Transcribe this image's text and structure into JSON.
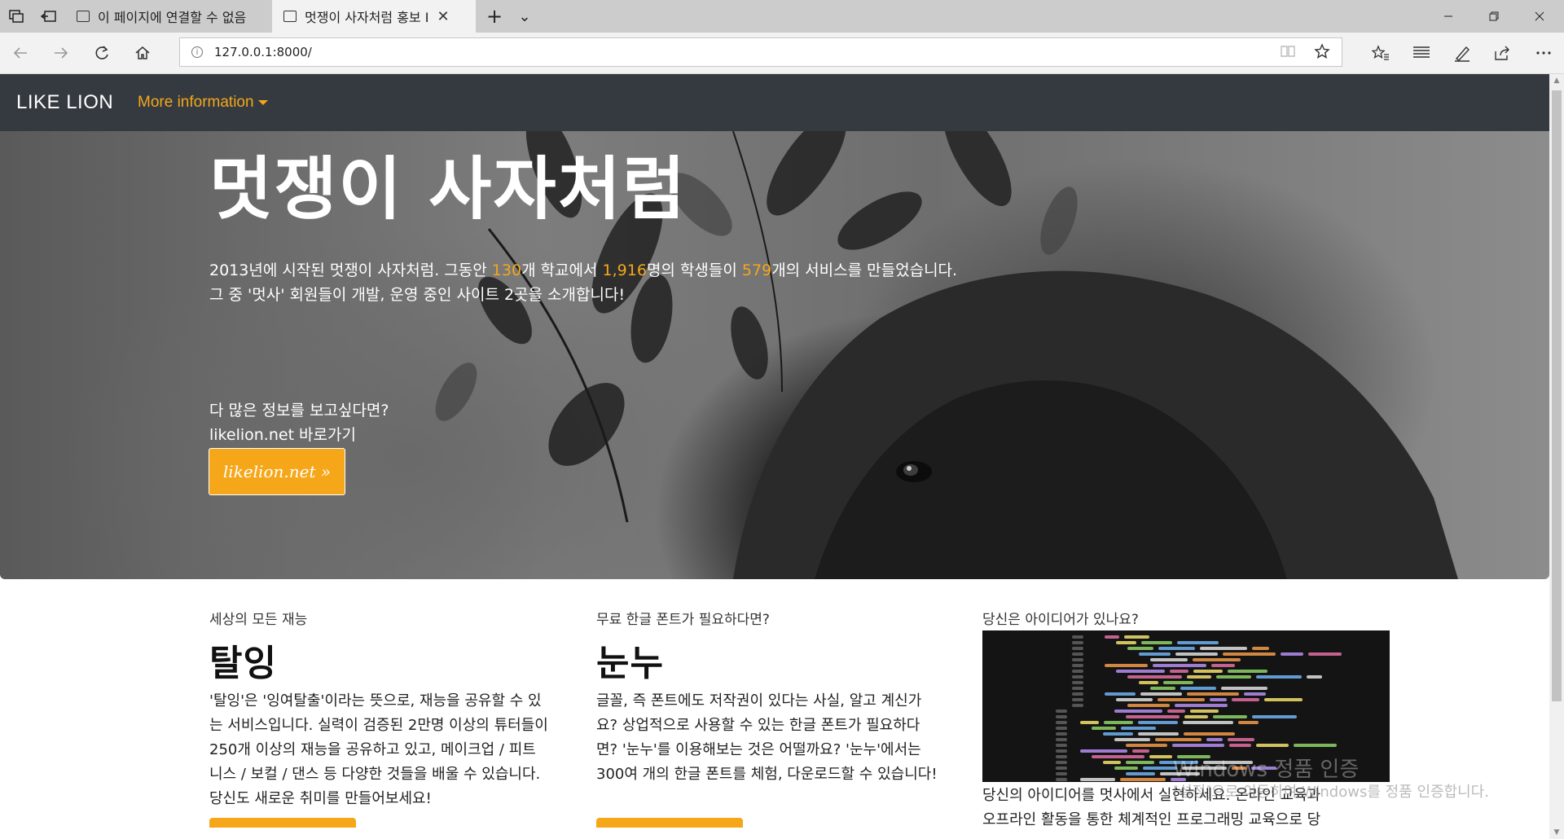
{
  "browser": {
    "tabs": [
      {
        "title": "이 페이지에 연결할 수 없음",
        "active": false
      },
      {
        "title": "멋쟁이 사자처럼 홍보 I",
        "active": true
      }
    ],
    "new_tab_glyph": "+",
    "tab_list_glyph": "⌄",
    "close_glyph": "✕",
    "url": "127.0.0.1:8000/",
    "window_controls": [
      "minimize-icon",
      "restore-icon",
      "close-icon"
    ]
  },
  "site": {
    "brand": "LIKE LION",
    "dropdown_label": "More information",
    "hero": {
      "title": "멋쟁이 사자처럼",
      "p1_a": "2013년에 시작된 멋쟁이 사자처럼. 그동안 ",
      "n_schools": "130",
      "p1_b": "개 학교에서 ",
      "n_students": "1,916",
      "p1_c": "명의 학생들이 ",
      "n_services": "579",
      "p1_d": "개의 서비스를 만들었습니다.",
      "p2": "그 중 '멋사' 회원들이 개발, 운영 중인 사이트 2곳을 소개합니다!",
      "more_q": "다 많은 정보를 보고싶다면?",
      "more_link": "likelion.net 바로가기",
      "button": "likelion.net »"
    },
    "cards": [
      {
        "subtitle": "세상의 모든 재능",
        "title": "탈잉",
        "lines": [
          "'탈잉'은 '잉여탈출'이라는 뜻으로, 재능을 공유할 수 있",
          "는 서비스입니다. 실력이 검증된 2만명 이상의 튜터들이",
          "250개 이상의 재능을 공유하고 있고, 메이크업 / 피트",
          "니스 / 보컬 / 댄스 등 다양한 것들을 배울 수 있습니다.",
          "당신도 새로운 취미를 만들어보세요!"
        ]
      },
      {
        "subtitle": "무료 한글 폰트가 필요하다면?",
        "title": "눈누",
        "lines": [
          "글꼴, 즉 폰트에도 저작권이 있다는 사실, 알고 계신가",
          "요? 상업적으로 사용할 수 있는 한글 폰트가 필요하다",
          "면? '눈누'를 이용해보는 것은 어떨까요? '눈누'에서는",
          "300여 개의 한글 폰트를 체험, 다운로드할 수 있습니다!"
        ]
      },
      {
        "subtitle": "당신은 아이디어가 있나요?",
        "lines": [
          "당신의 아이디어를 멋사에서 실현하세요. 온라인 교육과",
          "오프라인 활동을 통한 체계적인 프로그래밍 교육으로 당"
        ]
      }
    ],
    "watermark": {
      "line1": "Windows 정품 인증",
      "line2": "[설정]으로 이동하여 Windows를 정품 인증합니다."
    }
  },
  "colors": {
    "accent": "#f6a719",
    "navbar": "#343a40",
    "tabstrip": "#cccccc"
  }
}
